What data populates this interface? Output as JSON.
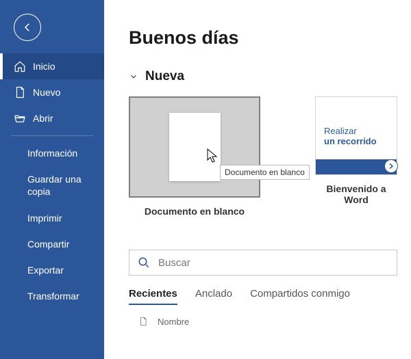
{
  "sidebar": {
    "items": [
      {
        "label": "Inicio"
      },
      {
        "label": "Nuevo"
      },
      {
        "label": "Abrir"
      }
    ],
    "sub": [
      "Información",
      "Guardar una copia",
      "Imprimir",
      "Compartir",
      "Exportar",
      "Transformar"
    ]
  },
  "main": {
    "greeting": "Buenos días",
    "section_new": "Nueva",
    "tile_blank_label": "Documento en blanco",
    "tile_blank_tooltip": "Documento en blanco",
    "tile_tour_line1": "Realizar",
    "tile_tour_line2": "un recorrido",
    "tile_tour_label": "Bienvenido a Word",
    "search_placeholder": "Buscar",
    "tabs": [
      "Recientes",
      "Anclado",
      "Compartidos conmigo"
    ],
    "list_header": "Nombre"
  }
}
